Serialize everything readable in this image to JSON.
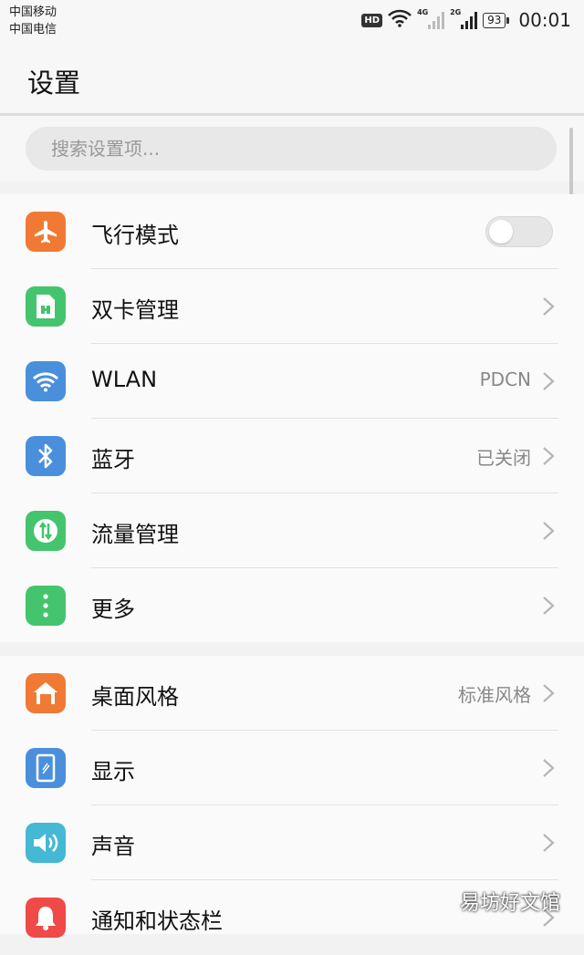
{
  "status_bar": {
    "carrier_1": "中国移动",
    "carrier_2": "中国电信",
    "hd": "HD",
    "net_1": "4G",
    "net_2": "2G",
    "battery": "93",
    "time": "00:01"
  },
  "header": {
    "title": "设置"
  },
  "search": {
    "placeholder": "搜索设置项..."
  },
  "groups": [
    {
      "items": [
        {
          "label": "飞行模式",
          "icon": "airplane-icon",
          "color": "#f07a34",
          "toggle": false
        },
        {
          "label": "双卡管理",
          "icon": "sim-card-icon",
          "color": "#45c46e",
          "value": ""
        },
        {
          "label": "WLAN",
          "icon": "wifi-icon",
          "color": "#4a8fdc",
          "value": "PDCN"
        },
        {
          "label": "蓝牙",
          "icon": "bluetooth-icon",
          "color": "#4a8fdc",
          "value": "已关闭"
        },
        {
          "label": "流量管理",
          "icon": "data-usage-icon",
          "color": "#45c46e",
          "value": ""
        },
        {
          "label": "更多",
          "icon": "more-dots-icon",
          "color": "#45c46e",
          "value": ""
        }
      ]
    },
    {
      "items": [
        {
          "label": "桌面风格",
          "icon": "home-icon",
          "color": "#f07a34",
          "value": "标准风格"
        },
        {
          "label": "显示",
          "icon": "display-icon",
          "color": "#4a8fdc",
          "value": ""
        },
        {
          "label": "声音",
          "icon": "speaker-icon",
          "color": "#44b8d4",
          "value": ""
        },
        {
          "label": "通知和状态栏",
          "icon": "bell-icon",
          "color": "#ef4a48",
          "value": ""
        }
      ]
    }
  ],
  "watermark": "易坊好文馆"
}
